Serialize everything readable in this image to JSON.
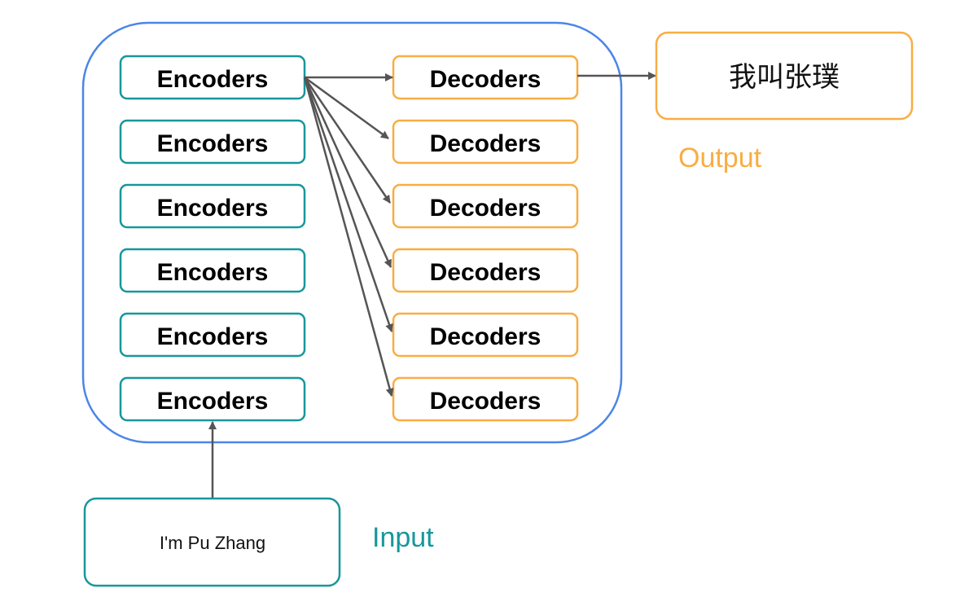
{
  "colors": {
    "encoder_border": "#17979c",
    "decoder_border": "#f9ad43",
    "container_border": "#4a86e8",
    "arrow": "#555555",
    "input_label": "#17979c",
    "output_label": "#f9ad43"
  },
  "encoders": [
    "Encoders",
    "Encoders",
    "Encoders",
    "Encoders",
    "Encoders",
    "Encoders"
  ],
  "decoders": [
    "Decoders",
    "Decoders",
    "Decoders",
    "Decoders",
    "Decoders",
    "Decoders"
  ],
  "input": {
    "text": "I'm Pu Zhang",
    "label": "Input"
  },
  "output": {
    "text": "我叫张璞",
    "label": "Output"
  }
}
